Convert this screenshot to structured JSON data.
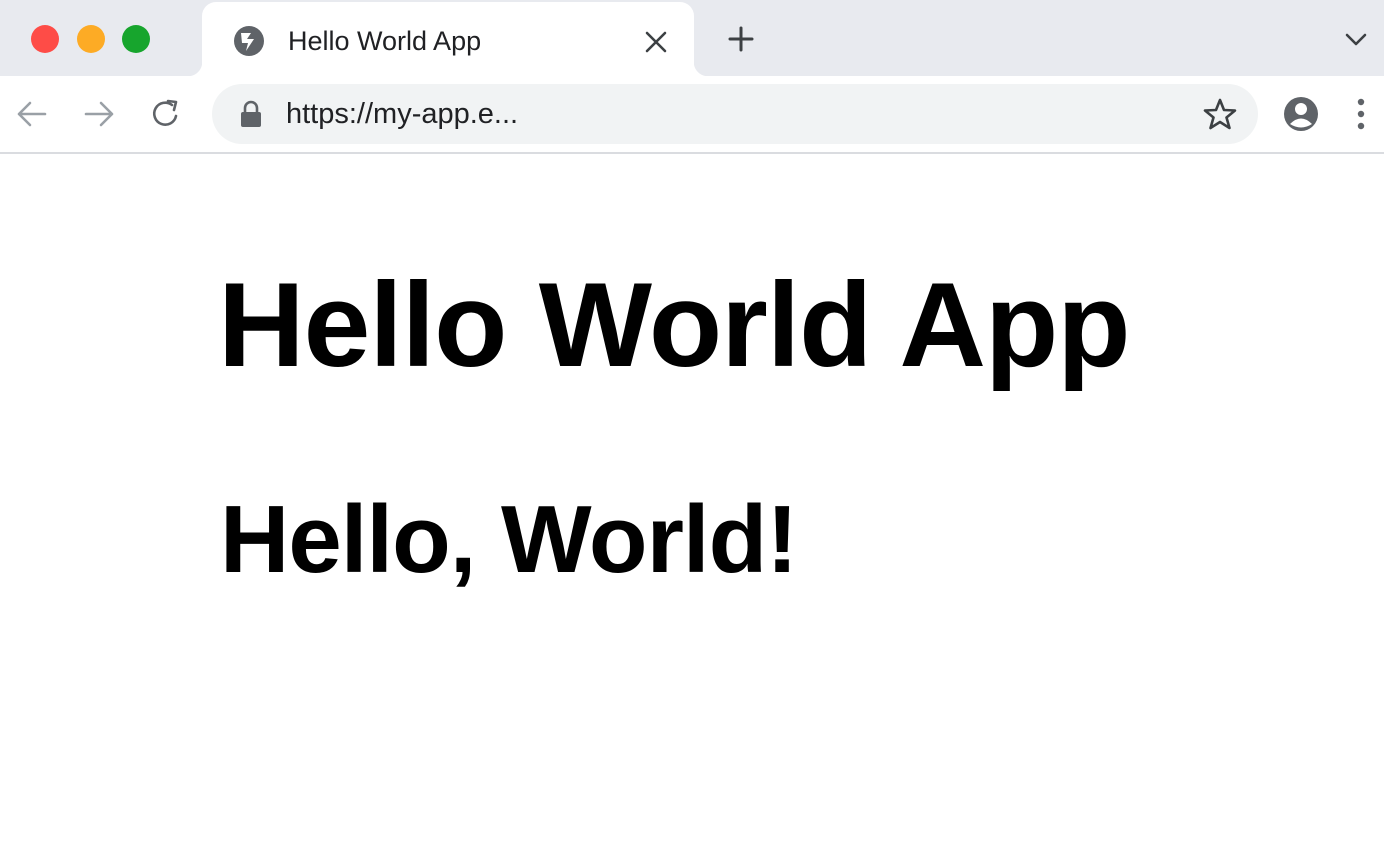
{
  "browser": {
    "tab": {
      "title": "Hello World App",
      "favicon": "globe-icon"
    },
    "toolbar": {
      "url": "https://my-app.e...",
      "icons": [
        "arrow-left-icon",
        "arrow-right-icon",
        "reload-icon",
        "lock-icon",
        "star-icon",
        "profile-icon",
        "more-vertical-icon"
      ]
    },
    "colors": {
      "close": "#fe4c47",
      "minimize": "#fdab25",
      "maximize": "#17a52d",
      "tabstrip": "#e8eaef",
      "omnibox": "#f1f3f4"
    }
  },
  "page": {
    "heading": "Hello World App",
    "subheading": "Hello, World!"
  }
}
